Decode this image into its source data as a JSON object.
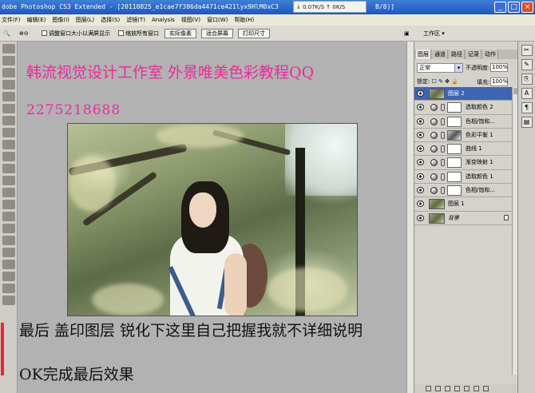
{
  "window": {
    "title": "dobe Photoshop CS3 Extended - [20110825_e1cae7f386da4471ce421lyx9HlM0xC3",
    "title_suffix": "B/8)]",
    "speed_text": "↓ 0.07K/S ↑ 0K/S",
    "minimize": "_",
    "maximize": "□",
    "close": "×"
  },
  "menu": [
    "文件(F)",
    "编辑(E)",
    "图像(I)",
    "图层(L)",
    "选择(S)",
    "滤镜(T)",
    "Analysis",
    "视图(V)",
    "窗口(W)",
    "帮助(H)"
  ],
  "options": {
    "resize_window": "调整窗口大小以满屏显示",
    "zoom_all": "缩放所有窗口",
    "actual_pixels": "实际像素",
    "fit_screen": "适合屏幕",
    "print_size": "打印尺寸",
    "workspace": "工作区 ▾"
  },
  "canvas": {
    "heading": "韩流视觉设计工作室 外景唯美色彩教程QQ",
    "qq": "2275218688",
    "body_line1": "最后 盖印图层 锐化下这里自己把握我就不详细说明",
    "body_line2": "OK完成最后效果"
  },
  "layers_panel": {
    "tabs": [
      "图层",
      "通道",
      "路径",
      "记录",
      "动作"
    ],
    "blend_mode": "正常",
    "opacity_label": "不透明度:",
    "opacity": "100%",
    "lock_label": "锁定:",
    "fill_label": "填充:",
    "fill": "100%",
    "layers": [
      {
        "name": "图层 2",
        "selected": true,
        "type": "pixel"
      },
      {
        "name": "选取颜色 2",
        "selected": false,
        "type": "adjust"
      },
      {
        "name": "色相/饱和...",
        "selected": false,
        "type": "adjust"
      },
      {
        "name": "色彩平衡 1",
        "selected": false,
        "type": "adjust"
      },
      {
        "name": "曲线 1",
        "selected": false,
        "type": "adjust"
      },
      {
        "name": "渐变映射 1",
        "selected": false,
        "type": "adjust"
      },
      {
        "name": "选取颜色 1",
        "selected": false,
        "type": "adjust"
      },
      {
        "name": "色相/饱和...",
        "selected": false,
        "type": "adjust"
      },
      {
        "name": "图层 1",
        "selected": false,
        "type": "pixel"
      },
      {
        "name": "背景",
        "selected": false,
        "type": "background"
      }
    ]
  },
  "colors": {
    "heading_text": "#ec2a9a",
    "selected_layer": "#3d64b5",
    "title_bar": "#1f55c0"
  }
}
